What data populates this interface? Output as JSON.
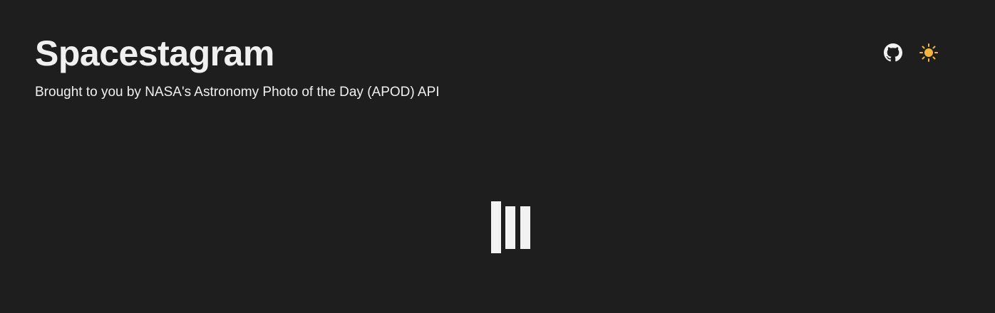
{
  "header": {
    "title": "Spacestagram",
    "subtitle": "Brought to you by NASA's Astronomy Photo of the Day (APOD) API"
  },
  "actions": {
    "github_icon": "github-icon",
    "theme_toggle_icon": "sun-icon",
    "sun_color": "#f5b640"
  },
  "loader": {
    "icon": "loading-bars-icon"
  }
}
